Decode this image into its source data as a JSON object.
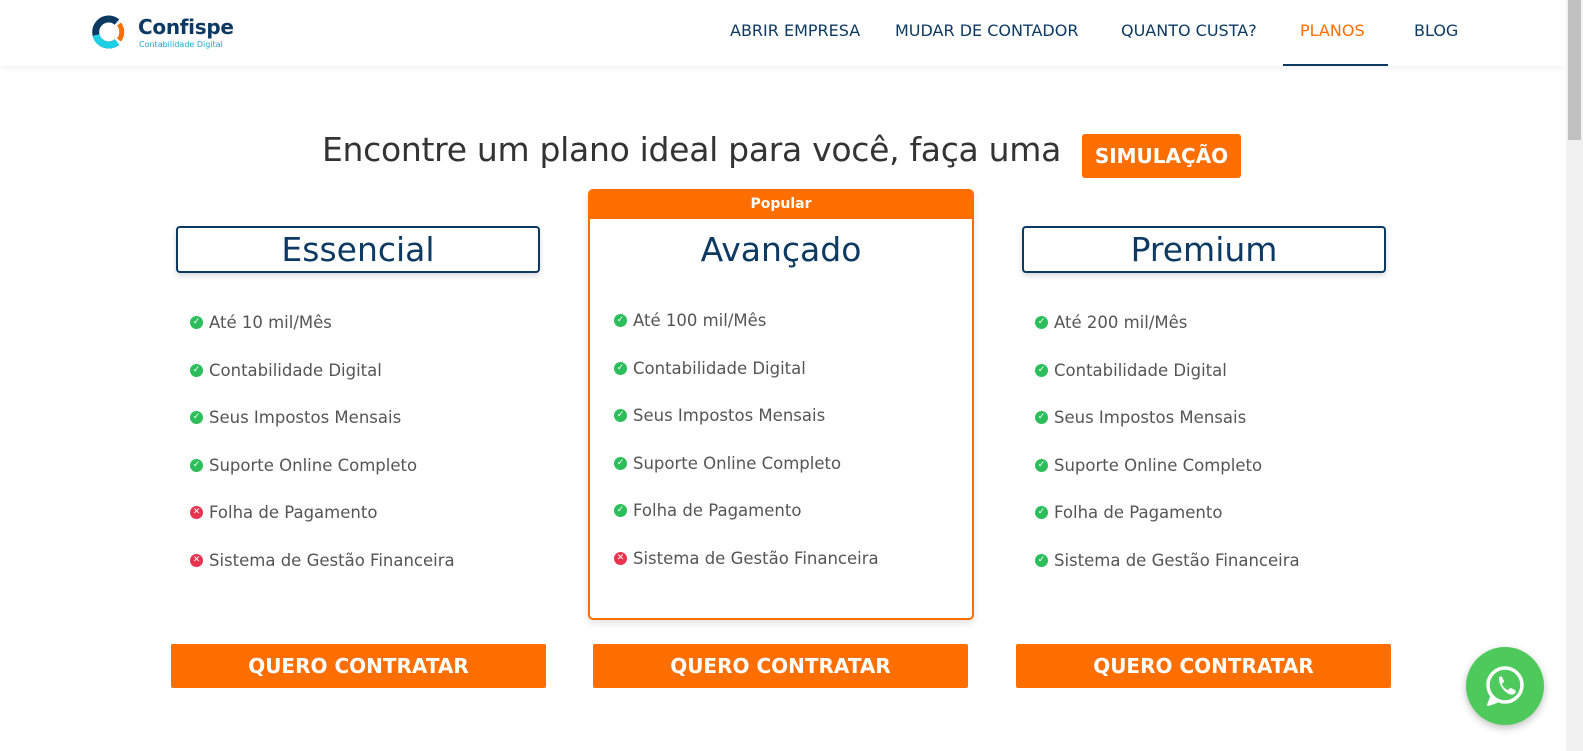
{
  "brand": {
    "name": "Confispe",
    "tagline": "Contabilidade Digital",
    "colors": {
      "navy": "#0d3a63",
      "orange": "#ff6e00",
      "cyan": "#1aa9d0",
      "check": "#2dbe5c",
      "cross": "#e8334f",
      "whatsapp": "#4ec95b"
    }
  },
  "nav": {
    "items": [
      {
        "label": "ABRIR EMPRESA"
      },
      {
        "label": "MUDAR DE CONTADOR"
      },
      {
        "label": "QUANTO CUSTA?"
      },
      {
        "label": "PLANOS",
        "active": true
      },
      {
        "label": "BLOG"
      }
    ]
  },
  "hero": {
    "headline": "Encontre um plano ideal para você, faça uma",
    "simulation_button": "SIMULAÇÃO"
  },
  "plans": [
    {
      "name": "Essencial",
      "features": [
        {
          "text": "Até 10 mil/Mês",
          "included": true
        },
        {
          "text": "Contabilidade Digital",
          "included": true
        },
        {
          "text": "Seus Impostos Mensais",
          "included": true
        },
        {
          "text": "Suporte Online Completo",
          "included": true
        },
        {
          "text": "Folha de Pagamento",
          "included": false
        },
        {
          "text": "Sistema de Gestão Financeira",
          "included": false
        }
      ],
      "cta": "QUERO CONTRATAR"
    },
    {
      "name": "Avançado",
      "badge": "Popular",
      "features": [
        {
          "text": "Até 100 mil/Mês",
          "included": true
        },
        {
          "text": "Contabilidade Digital",
          "included": true
        },
        {
          "text": "Seus Impostos Mensais",
          "included": true
        },
        {
          "text": "Suporte Online Completo",
          "included": true
        },
        {
          "text": "Folha de Pagamento",
          "included": true
        },
        {
          "text": "Sistema de Gestão Financeira",
          "included": false
        }
      ],
      "cta": "QUERO CONTRATAR"
    },
    {
      "name": "Premium",
      "features": [
        {
          "text": "Até 200 mil/Mês",
          "included": true
        },
        {
          "text": "Contabilidade Digital",
          "included": true
        },
        {
          "text": "Seus Impostos Mensais",
          "included": true
        },
        {
          "text": "Suporte Online Completo",
          "included": true
        },
        {
          "text": "Folha de Pagamento",
          "included": true
        },
        {
          "text": "Sistema de Gestão Financeira",
          "included": true
        }
      ],
      "cta": "QUERO CONTRATAR"
    }
  ],
  "icons": {
    "included": "check-circle-icon",
    "excluded": "x-circle-icon",
    "chat": "whatsapp-icon"
  }
}
